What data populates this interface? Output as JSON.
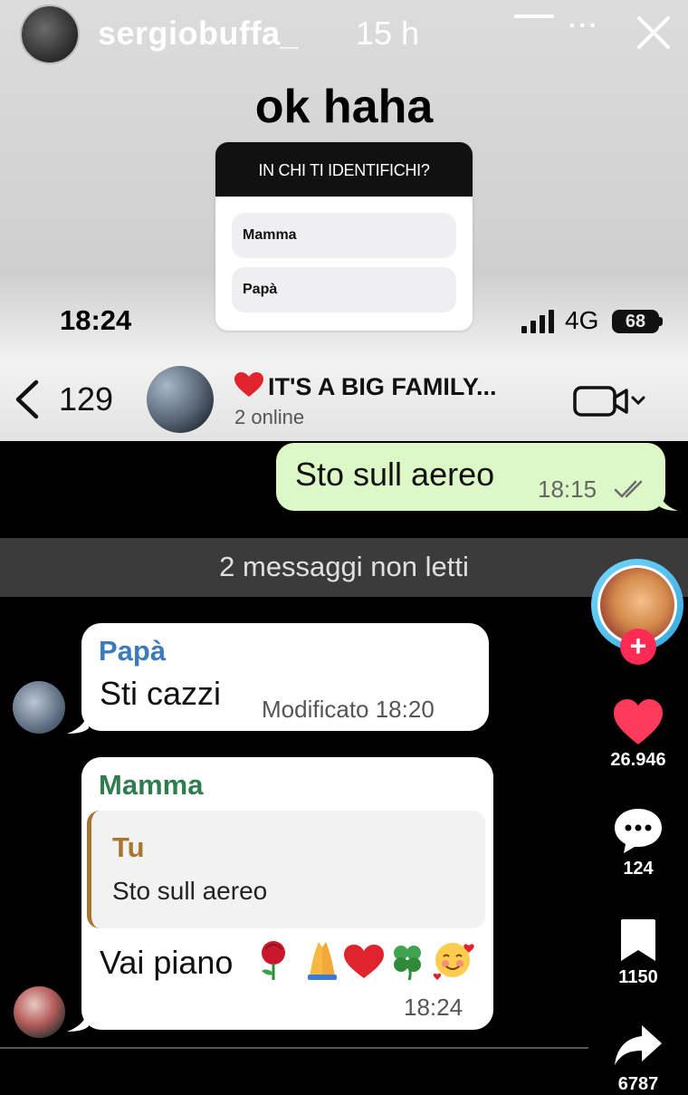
{
  "story": {
    "username": "sergiobuffa_",
    "time_ago": "15 h",
    "more_label": "···",
    "caption": "ok haha"
  },
  "poll": {
    "question": "IN CHI TI IDENTIFICHI?",
    "options": [
      "Mamma",
      "Papà"
    ]
  },
  "status_bar": {
    "time": "18:24",
    "network": "4G",
    "battery": "68"
  },
  "chat_header": {
    "back_count": "129",
    "group_name": "IT'S A BIG FAMILY...",
    "status": "2 online"
  },
  "messages": {
    "outgoing": {
      "text": "Sto sull aereo",
      "time": "18:15"
    },
    "unread_banner": "2 messaggi non letti",
    "papa": {
      "sender": "Papà",
      "text": "Sti cazzi",
      "edited_time": "Modificato 18:20"
    },
    "mamma": {
      "sender": "Mamma",
      "quote_sender": "Tu",
      "quote_text": "Sto sull aereo",
      "text": "Vai piano",
      "emojis": "🌹🙏❤️🍀🥰",
      "time": "18:24"
    }
  },
  "actions": {
    "likes": "26.946",
    "comments": "124",
    "saves": "1150",
    "shares": "6787"
  },
  "colors": {
    "outgoing_bubble": "#dcf8c6",
    "papa_name": "#3b7bbd",
    "mamma_name": "#2e7d4f",
    "quote_accent": "#a8772f",
    "like_heart": "#ff3b5c",
    "follow_button": "#ff2b55"
  }
}
